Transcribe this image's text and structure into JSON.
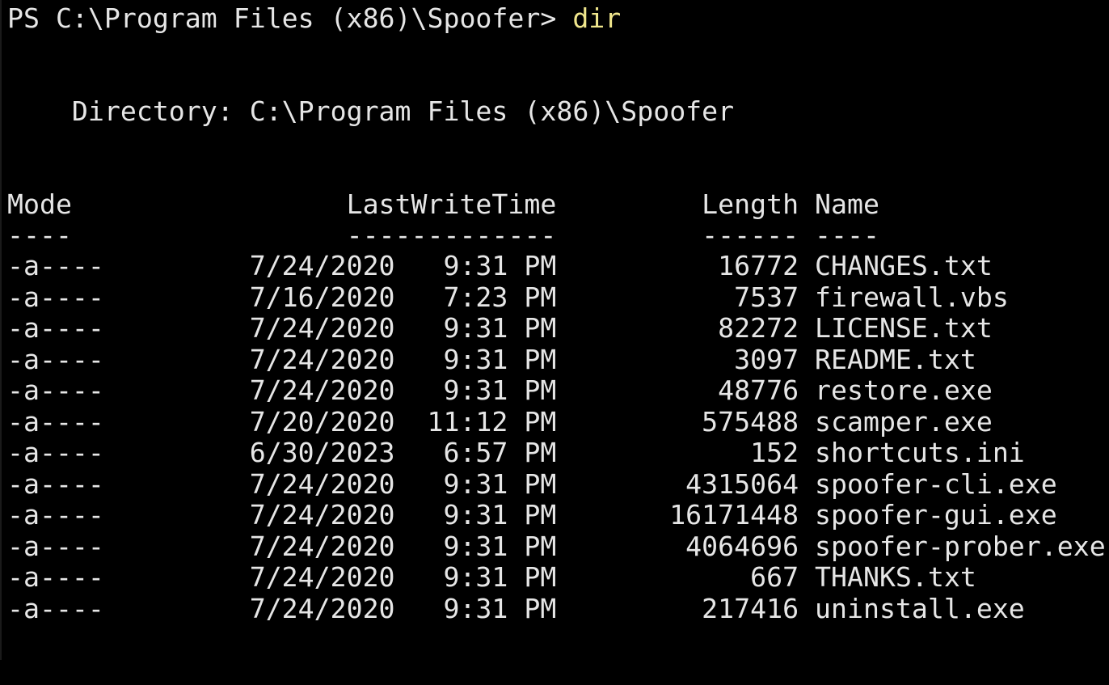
{
  "prompt": {
    "path": "PS C:\\Program Files (x86)\\Spoofer> ",
    "command": "dir"
  },
  "directory_line": "    Directory: C:\\Program Files (x86)\\Spoofer",
  "table": {
    "header": "Mode                 LastWriteTime         Length Name",
    "underline": "----                 -------------         ------ ----",
    "rows": [
      "-a----         7/24/2020   9:31 PM          16772 CHANGES.txt",
      "-a----         7/16/2020   7:23 PM           7537 firewall.vbs",
      "-a----         7/24/2020   9:31 PM          82272 LICENSE.txt",
      "-a----         7/24/2020   9:31 PM           3097 README.txt",
      "-a----         7/24/2020   9:31 PM          48776 restore.exe",
      "-a----         7/20/2020  11:12 PM         575488 scamper.exe",
      "-a----         6/30/2023   6:57 PM            152 shortcuts.ini",
      "-a----         7/24/2020   9:31 PM        4315064 spoofer-cli.exe",
      "-a----         7/24/2020   9:31 PM       16171448 spoofer-gui.exe",
      "-a----         7/24/2020   9:31 PM        4064696 spoofer-prober.exe",
      "-a----         7/24/2020   9:31 PM            667 THANKS.txt",
      "-a----         7/24/2020   9:31 PM         217416 uninstall.exe"
    ]
  },
  "colors": {
    "background": "#000000",
    "text": "#e6e6e6",
    "command": "#f0e68c"
  }
}
